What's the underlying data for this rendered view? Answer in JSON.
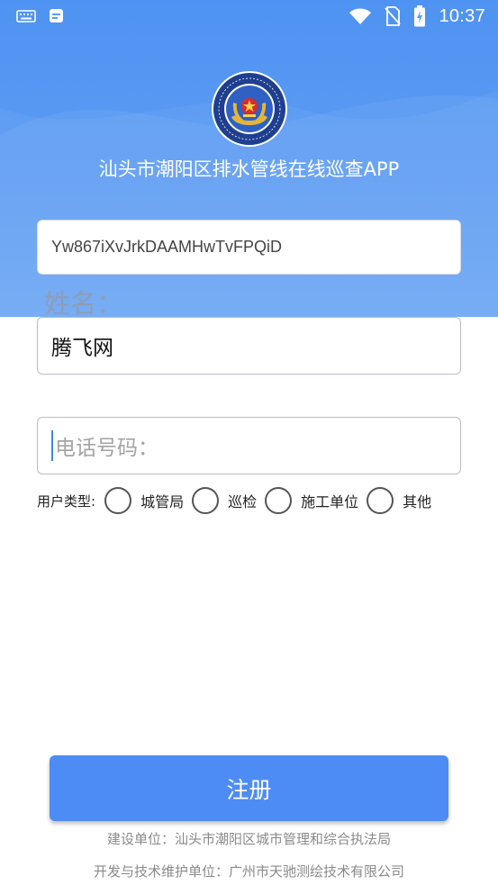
{
  "status_bar": {
    "time": "10:37",
    "icons": [
      "keyboard-icon",
      "notification-app-icon",
      "wifi-icon",
      "no-sim-icon",
      "battery-charging-icon"
    ]
  },
  "header": {
    "app_title": "汕头市潮阳区排水管线在线巡查APP",
    "emblem_text": "城市管理执法",
    "emblem_ring_text": "URBAN MANAGEMENT AND LAW ENFORCEMENT"
  },
  "form": {
    "device_id_value": "Yw867iXvJrkDAAMHwTvFPQiD",
    "name_label": "姓名：",
    "name_value": "腾飞网",
    "phone_placeholder": "电话号码："
  },
  "user_type": {
    "label": "用户类型:",
    "options": [
      "城管局",
      "巡检",
      "施工单位",
      "其他"
    ]
  },
  "actions": {
    "register_label": "注册"
  },
  "footer": {
    "construction_unit": "建设单位：汕头市潮阳区城市管理和综合执法局",
    "developer_unit": "开发与技术维护单位：广州市天驰测绘技术有限公司"
  },
  "colors": {
    "header_blue": "#5b9bf3",
    "button_blue": "#4d8cf4",
    "caret_blue": "#3c8ce7"
  }
}
